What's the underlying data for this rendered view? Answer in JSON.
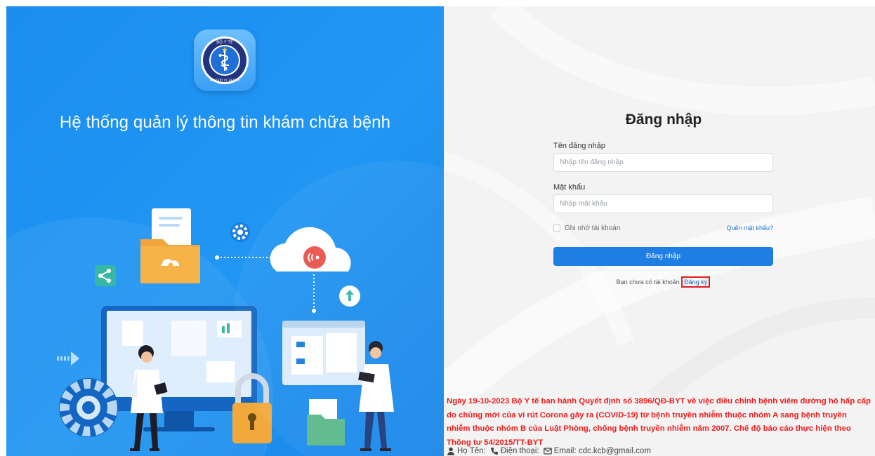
{
  "left": {
    "app_title": "Hệ thống quản lý thông tin khám chữa bệnh",
    "logo_top_text": "BỘ Y TẾ",
    "logo_bottom_text": "MINISTRY OF HEALTH",
    "brand_color": "#2196f3"
  },
  "login": {
    "title": "Đăng nhập",
    "username_label": "Tên đăng nhập",
    "username_placeholder": "Nhập tên đăng nhập",
    "password_label": "Mật khẩu",
    "password_placeholder": "Nhập mật khẩu",
    "remember_label": "Ghi nhớ tài khoản",
    "forgot_label": "Quên mật khẩu?",
    "submit_label": "Đăng nhập",
    "no_account_text": "Bạn chưa có tài khoản",
    "signup_label": "Đăng ký",
    "button_color": "#1e7ee4",
    "highlight_color": "#e11d1d"
  },
  "notice": {
    "text": "Ngày 19-10-2023 Bộ Y tế ban hành Quyết định số 3896/QĐ-BYT về việc điều chỉnh bệnh viêm đường hô hấp cấp do chủng mới của vi rút Corona gây ra (COVID-19) từ bệnh truyền nhiễm thuộc nhóm A sang bệnh truyền nhiễm thuộc nhóm B của Luật Phòng, chống bệnh truyền nhiễm năm 2007. Chế độ báo cáo thực hiện theo Thông tư 54/2015/TT-BYT",
    "color": "#ee1c1c"
  },
  "contact": {
    "name_label": "Họ Tên:",
    "phone_label": "Điện thoại:",
    "email_label": "Email: cdc.kcb@gmail.com"
  }
}
